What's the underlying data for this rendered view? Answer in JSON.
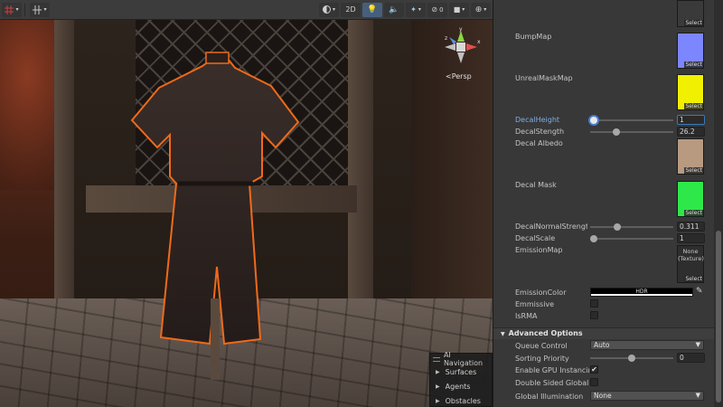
{
  "scene": {
    "toolbar": {
      "mode_2d_label": "2D"
    },
    "persp_label": "<Persp",
    "gizmo_axes": {
      "y": "y",
      "x": "x",
      "z": "z"
    },
    "ai_navigation": {
      "title": "AI Navigation",
      "items": [
        {
          "label": "Surfaces"
        },
        {
          "label": "Agents"
        },
        {
          "label": "Obstacles"
        }
      ]
    }
  },
  "inspector": {
    "select_label": "Select",
    "textures": [
      {
        "label": "BumpMap",
        "color": "#7c86ff"
      },
      {
        "label": "UnrealMaskMap",
        "color": "#f0f000"
      }
    ],
    "decal_height": {
      "label": "DecalHeight",
      "value": "1",
      "slider_fraction": 0.0
    },
    "decal_strength": {
      "label": "DecalStength",
      "value": "26.2",
      "slider_fraction": 0.3
    },
    "decal_albedo": {
      "label": "Decal Albedo",
      "color": "#b89a80"
    },
    "decal_mask": {
      "label": "Decal Mask",
      "color": "#2ee84a"
    },
    "decal_normal_strength": {
      "label": "DecalNormalStrength",
      "display_label": "DecalNormalStrengtl",
      "value": "0.311",
      "slider_fraction": 0.311
    },
    "decal_scale": {
      "label": "DecalScale",
      "value": "1",
      "slider_fraction": 0.0
    },
    "emission_map": {
      "label": "EmissionMap",
      "slot_text_1": "None",
      "slot_text_2": "(Texture)"
    },
    "emission_color": {
      "label": "EmissionColor",
      "hdr_label": "HDR"
    },
    "emmissive": {
      "label": "Emmissive",
      "checked": false
    },
    "is_rma": {
      "label": "IsRMA",
      "checked": false
    },
    "advanced_options": {
      "title": "Advanced Options",
      "queue_control": {
        "label": "Queue Control",
        "value": "Auto"
      },
      "sorting_priority": {
        "label": "Sorting Priority",
        "value": "0",
        "slider_fraction": 0.5
      },
      "gpu_instancing": {
        "label": "Enable GPU Instancing",
        "checked": true,
        "check_glyph": "✔"
      },
      "double_sided": {
        "label": "Double Sided Global Il",
        "checked": false
      },
      "global_illumination": {
        "label": "Global Illumination",
        "value": "None"
      }
    }
  }
}
